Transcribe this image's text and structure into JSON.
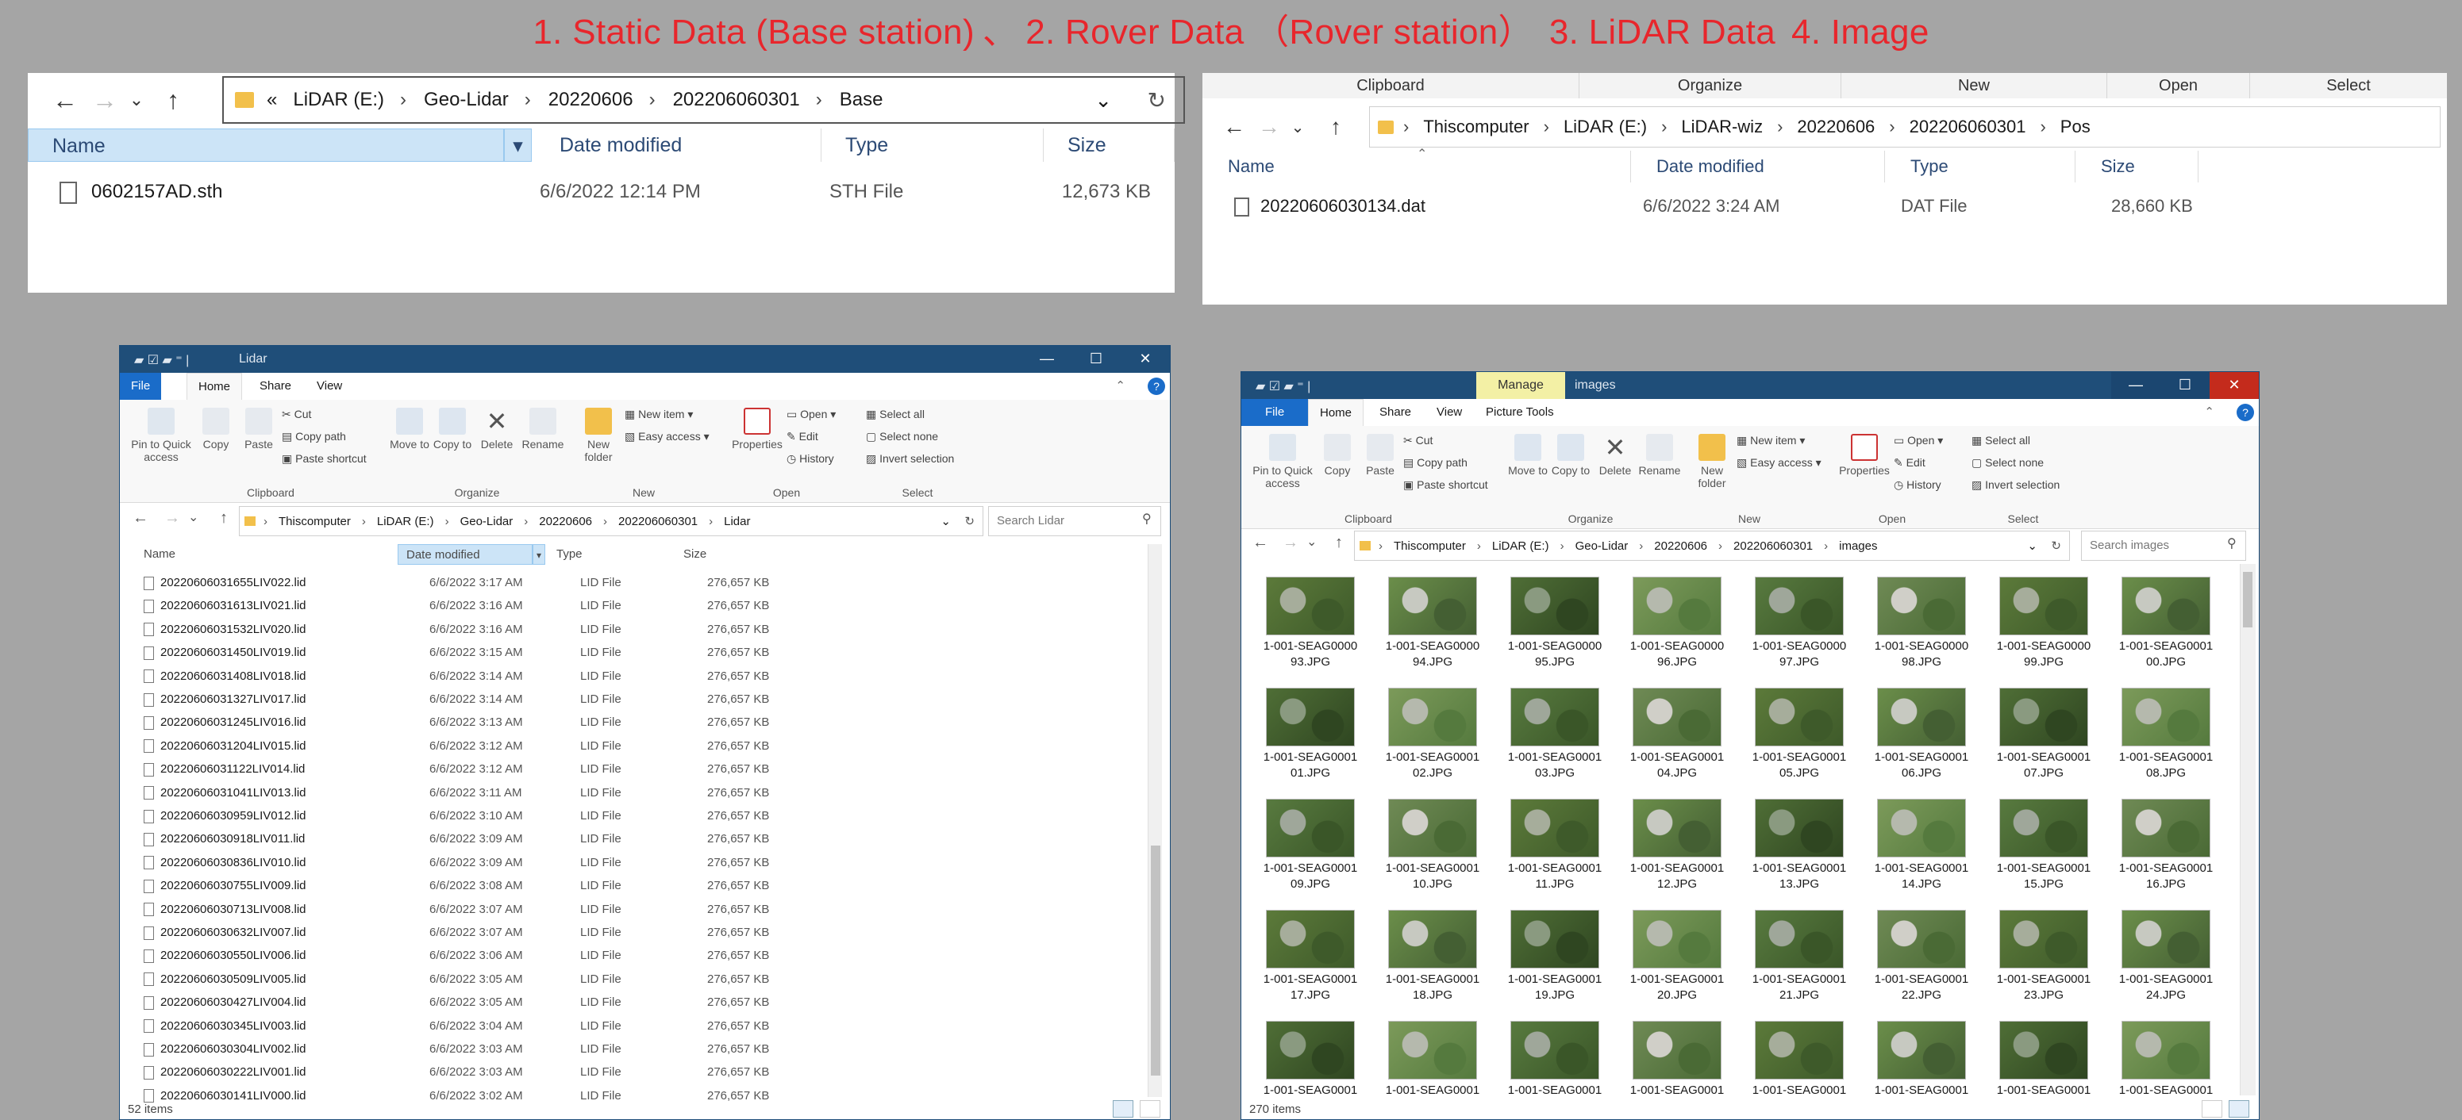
{
  "caption": {
    "p1": "1. Static Data (Base station)",
    "sep1": "、",
    "p2": "2. Rover Data （Rover station）",
    "p3": "3. LiDAR Data",
    "p4": "4. Image"
  },
  "base_panel": {
    "breadcrumb": [
      "«",
      "LiDAR (E:)",
      "Geo-Lidar",
      "20220606",
      "202206060301",
      "Base"
    ],
    "columns": [
      "Name",
      "Date modified",
      "Type",
      "Size"
    ],
    "files": [
      {
        "name": "0602157AD.sth",
        "date": "6/6/2022 12:14 PM",
        "type": "STH File",
        "size": "12,673 KB"
      }
    ]
  },
  "pos_panel": {
    "ribbon_groups": [
      "Clipboard",
      "Organize",
      "New",
      "Open",
      "Select"
    ],
    "breadcrumb": [
      "Thiscomputer",
      "LiDAR (E:)",
      "LiDAR-wiz",
      "20220606",
      "202206060301",
      "Pos"
    ],
    "columns": [
      "Name",
      "Date modified",
      "Type",
      "Size"
    ],
    "files": [
      {
        "name": "20220606030134.dat",
        "date": "6/6/2022 3:24 AM",
        "type": "DAT File",
        "size": "28,660 KB"
      }
    ]
  },
  "ribbon": {
    "pin": "Pin to Quick access",
    "copy": "Copy",
    "paste": "Paste",
    "cut": "Cut",
    "copy_path": "Copy path",
    "paste_shortcut": "Paste shortcut",
    "move_to": "Move to",
    "copy_to": "Copy to",
    "delete": "Delete",
    "rename": "Rename",
    "new_folder": "New folder",
    "new_item": "New item",
    "easy_access": "Easy access",
    "properties": "Properties",
    "open": "Open",
    "edit": "Edit",
    "history": "History",
    "select_all": "Select all",
    "select_none": "Select none",
    "invert_selection": "Invert selection",
    "groups": {
      "clipboard": "Clipboard",
      "organize": "Organize",
      "new": "New",
      "open": "Open",
      "select": "Select"
    }
  },
  "lidar_window": {
    "title": "Lidar",
    "tabs": [
      "File",
      "Home",
      "Share",
      "View"
    ],
    "breadcrumb": [
      "Thiscomputer",
      "LiDAR (E:)",
      "Geo-Lidar",
      "20220606",
      "202206060301",
      "Lidar"
    ],
    "search_placeholder": "Search Lidar",
    "columns": [
      "Name",
      "Date modified",
      "Type",
      "Size"
    ],
    "files": [
      {
        "name": "20220606031655LIV022.lid",
        "date": "6/6/2022 3:17 AM",
        "type": "LID File",
        "size": "276,657 KB"
      },
      {
        "name": "20220606031613LIV021.lid",
        "date": "6/6/2022 3:16 AM",
        "type": "LID File",
        "size": "276,657 KB"
      },
      {
        "name": "20220606031532LIV020.lid",
        "date": "6/6/2022 3:16 AM",
        "type": "LID File",
        "size": "276,657 KB"
      },
      {
        "name": "20220606031450LIV019.lid",
        "date": "6/6/2022 3:15 AM",
        "type": "LID File",
        "size": "276,657 KB"
      },
      {
        "name": "20220606031408LIV018.lid",
        "date": "6/6/2022 3:14 AM",
        "type": "LID File",
        "size": "276,657 KB"
      },
      {
        "name": "20220606031327LIV017.lid",
        "date": "6/6/2022 3:14 AM",
        "type": "LID File",
        "size": "276,657 KB"
      },
      {
        "name": "20220606031245LIV016.lid",
        "date": "6/6/2022 3:13 AM",
        "type": "LID File",
        "size": "276,657 KB"
      },
      {
        "name": "20220606031204LIV015.lid",
        "date": "6/6/2022 3:12 AM",
        "type": "LID File",
        "size": "276,657 KB"
      },
      {
        "name": "20220606031122LIV014.lid",
        "date": "6/6/2022 3:12 AM",
        "type": "LID File",
        "size": "276,657 KB"
      },
      {
        "name": "20220606031041LIV013.lid",
        "date": "6/6/2022 3:11 AM",
        "type": "LID File",
        "size": "276,657 KB"
      },
      {
        "name": "20220606030959LIV012.lid",
        "date": "6/6/2022 3:10 AM",
        "type": "LID File",
        "size": "276,657 KB"
      },
      {
        "name": "20220606030918LIV011.lid",
        "date": "6/6/2022 3:09 AM",
        "type": "LID File",
        "size": "276,657 KB"
      },
      {
        "name": "20220606030836LIV010.lid",
        "date": "6/6/2022 3:09 AM",
        "type": "LID File",
        "size": "276,657 KB"
      },
      {
        "name": "20220606030755LIV009.lid",
        "date": "6/6/2022 3:08 AM",
        "type": "LID File",
        "size": "276,657 KB"
      },
      {
        "name": "20220606030713LIV008.lid",
        "date": "6/6/2022 3:07 AM",
        "type": "LID File",
        "size": "276,657 KB"
      },
      {
        "name": "20220606030632LIV007.lid",
        "date": "6/6/2022 3:07 AM",
        "type": "LID File",
        "size": "276,657 KB"
      },
      {
        "name": "20220606030550LIV006.lid",
        "date": "6/6/2022 3:06 AM",
        "type": "LID File",
        "size": "276,657 KB"
      },
      {
        "name": "20220606030509LIV005.lid",
        "date": "6/6/2022 3:05 AM",
        "type": "LID File",
        "size": "276,657 KB"
      },
      {
        "name": "20220606030427LIV004.lid",
        "date": "6/6/2022 3:05 AM",
        "type": "LID File",
        "size": "276,657 KB"
      },
      {
        "name": "20220606030345LIV003.lid",
        "date": "6/6/2022 3:04 AM",
        "type": "LID File",
        "size": "276,657 KB"
      },
      {
        "name": "20220606030304LIV002.lid",
        "date": "6/6/2022 3:03 AM",
        "type": "LID File",
        "size": "276,657 KB"
      },
      {
        "name": "20220606030222LIV001.lid",
        "date": "6/6/2022 3:03 AM",
        "type": "LID File",
        "size": "276,657 KB"
      },
      {
        "name": "20220606030141LIV000.lid",
        "date": "6/6/2022 3:02 AM",
        "type": "LID File",
        "size": "276,657 KB"
      }
    ],
    "status": "52 items"
  },
  "images_window": {
    "title": "images",
    "manage": "Manage",
    "tabs": [
      "File",
      "Home",
      "Share",
      "View",
      "Picture Tools"
    ],
    "breadcrumb": [
      "Thiscomputer",
      "LiDAR (E:)",
      "Geo-Lidar",
      "20220606",
      "202206060301",
      "images"
    ],
    "search_placeholder": "Search images",
    "images": [
      "1-001-SEAG0000\n93.JPG",
      "1-001-SEAG0000\n94.JPG",
      "1-001-SEAG0000\n95.JPG",
      "1-001-SEAG0000\n96.JPG",
      "1-001-SEAG0000\n97.JPG",
      "1-001-SEAG0000\n98.JPG",
      "1-001-SEAG0000\n99.JPG",
      "1-001-SEAG0001\n00.JPG",
      "1-001-SEAG0001\n01.JPG",
      "1-001-SEAG0001\n02.JPG",
      "1-001-SEAG0001\n03.JPG",
      "1-001-SEAG0001\n04.JPG",
      "1-001-SEAG0001\n05.JPG",
      "1-001-SEAG0001\n06.JPG",
      "1-001-SEAG0001\n07.JPG",
      "1-001-SEAG0001\n08.JPG",
      "1-001-SEAG0001\n09.JPG",
      "1-001-SEAG0001\n10.JPG",
      "1-001-SEAG0001\n11.JPG",
      "1-001-SEAG0001\n12.JPG",
      "1-001-SEAG0001\n13.JPG",
      "1-001-SEAG0001\n14.JPG",
      "1-001-SEAG0001\n15.JPG",
      "1-001-SEAG0001\n16.JPG",
      "1-001-SEAG0001\n17.JPG",
      "1-001-SEAG0001\n18.JPG",
      "1-001-SEAG0001\n19.JPG",
      "1-001-SEAG0001\n20.JPG",
      "1-001-SEAG0001\n21.JPG",
      "1-001-SEAG0001\n22.JPG",
      "1-001-SEAG0001\n23.JPG",
      "1-001-SEAG0001\n24.JPG",
      "1-001-SEAG0001",
      "1-001-SEAG0001",
      "1-001-SEAG0001",
      "1-001-SEAG0001",
      "1-001-SEAG0001",
      "1-001-SEAG0001",
      "1-001-SEAG0001",
      "1-001-SEAG0001"
    ],
    "status": "270 items"
  },
  "colors": {
    "caption": "#e8262c",
    "titlebar": "#1f4e79",
    "file_tab": "#1a6cc9",
    "manage": "#f3f0a5",
    "close": "#c42b1c"
  }
}
